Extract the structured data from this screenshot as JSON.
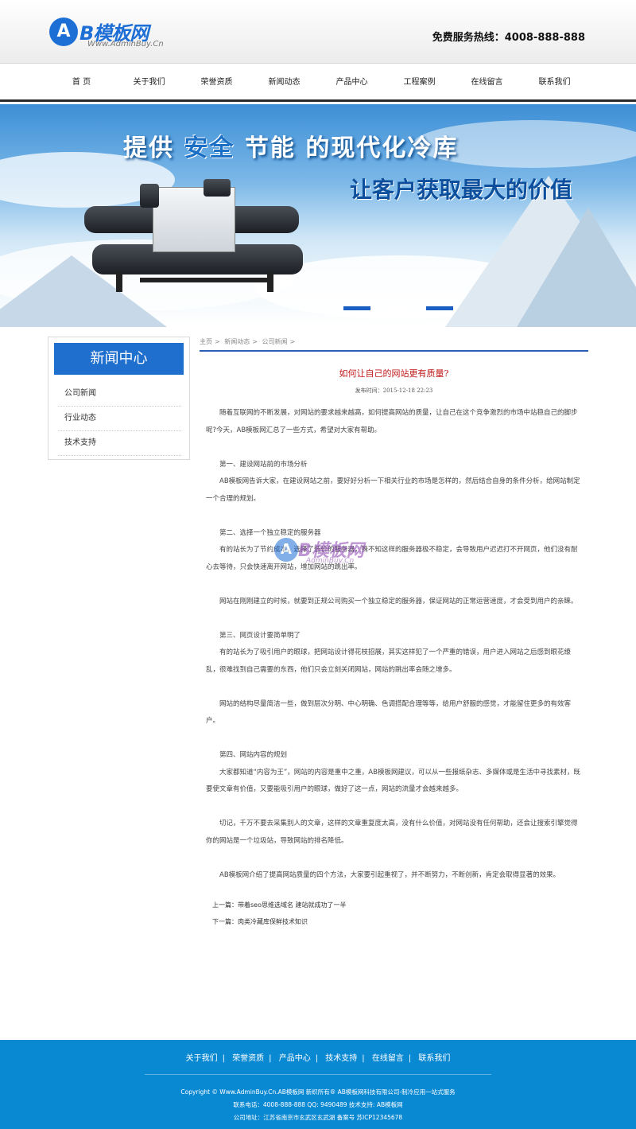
{
  "header": {
    "logo_letter": "A",
    "logo_text": "B模板网",
    "logo_url": "Www.AdminBuy.Cn",
    "hotline": "免费服务热线：4008-888-888"
  },
  "nav": {
    "items": [
      "首 页",
      "关于我们",
      "荣誉资质",
      "新闻动态",
      "产品中心",
      "工程案例",
      "在线留言",
      "联系我们"
    ]
  },
  "banner": {
    "slogan_line1_a": "提供 ",
    "slogan_line1_safe": "安全",
    "slogan_line1_b": " 节能 ",
    "slogan_line1_c": "的现代化冷库",
    "slogan_line2": "让客户获取最大的价值"
  },
  "sidebar": {
    "title": "新闻中心",
    "items": [
      "公司新闻",
      "行业动态",
      "技术支持"
    ]
  },
  "breadcrumb": {
    "items": [
      "主页",
      "新闻动态",
      "公司新闻"
    ],
    "sep": ">"
  },
  "article": {
    "title": "如何让自己的网站更有质量?",
    "date": "发布时间：2015-12-18 22:23",
    "paragraphs": [
      "随着互联网的不断发展，对网站的要求越来越高，如何提高网站的质量，让自己在这个竞争激烈的市场中站稳自己的脚步呢?今天，AB模板网汇总了一些方式，希望对大家有帮助。",
      "",
      "第一、建设网站前的市场分析",
      "AB模板网告诉大家，在建设网站之前，要好好分析一下相关行业的市场是怎样的，然后结合自身的条件分析，给网站制定一个合理的规划。",
      "",
      "第二、选择一个独立稳定的服务器",
      "有的站长为了节约成本，选择了低价的服务器，殊不知这样的服务器极不稳定，会导致用户迟迟打不开网页，他们没有耐心去等待，只会快速离开网站，增加网站的跳出率。",
      "",
      "网站在刚刚建立的时候，就要到正规公司购买一个独立稳定的服务器，保证网站的正常运营速度，才会受到用户的亲睐。",
      "",
      "第三、网页设计要简单明了",
      "有的站长为了吸引用户的眼球，把网站设计得花枝招展，其实这样犯了一个严重的错误，用户进入网站之后感到眼花缭乱，很难找到自己需要的东西，他们只会立刻关闭网站，网站的跳出率会随之增多。",
      "",
      "网站的结构尽量简洁一些，做到层次分明、中心明确、色调搭配合理等等，给用户舒服的感觉，才能留住更多的有效客户。",
      "",
      "第四、网站内容的规划",
      "大家都知道“内容为王”，网站的内容是重中之重，AB模板网建议，可以从一些报纸杂志、多媒体或是生活中寻找素材，既要使文章有价值，又要能吸引用户的眼球，做好了这一点，网站的流量才会越来越多。",
      "",
      "切记，千万不要去采集别人的文章，这样的文章重复度太高，没有什么价值，对网站没有任何帮助，还会让搜索引擎觉得你的网站是一个垃圾站，导致网站的排名降低。",
      "",
      "AB模板网介绍了提高网站质量的四个方法，大家要引起重视了，并不断努力，不断创新，肯定会取得显著的效果。"
    ],
    "prev_label": "上一篇：",
    "prev_title": "带着seo思维选域名 建站就成功了一半",
    "next_label": "下一篇：",
    "next_title": "肉类冷藏库保鲜技术知识"
  },
  "watermark": {
    "letter": "A",
    "text": "B模板网",
    "url": "AdminBuy.Cn"
  },
  "footer": {
    "links": [
      "关于我们",
      "荣誉资质",
      "产品中心",
      "技术支持",
      "在线留言",
      "联系我们"
    ],
    "sep": "|",
    "copyright": "Copyright © Www.AdminBuy.Cn.AB模板网 新织所有® AB模板网科技有限公司-制冷应用一站式服务",
    "contact": "联系电话：4008-888-888 QQ: 9490489 技术支持: AB模板网",
    "address": "公司地址：江苏省南京市玄武区玄武湖 备案号 苏ICP12345678"
  },
  "colors": {
    "brand_blue": "#1f6fcf",
    "footer_blue": "#0a89d3",
    "title_red": "#c01818"
  }
}
